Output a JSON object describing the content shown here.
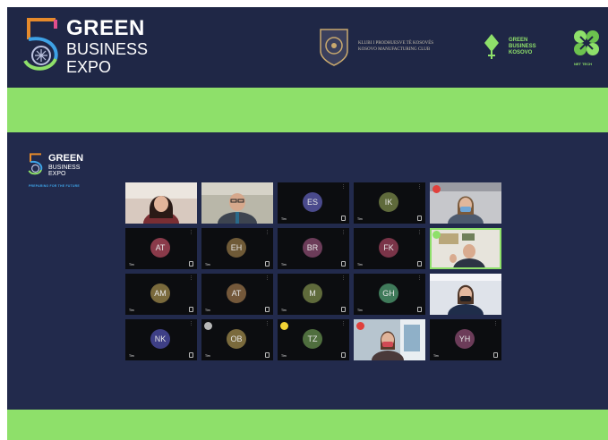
{
  "header": {
    "logo_number": "5",
    "logo_line1": "GREEN",
    "logo_line2": "BUSINESS",
    "logo_line3": "EXPO",
    "kmc_line1": "KLUBI I PRODHUESVE TË KOSOVËS",
    "kmc_line2": "KOSOVO MANUFACTURING CLUB",
    "gbk_line1": "GREEN",
    "gbk_line2": "BUSINESS",
    "gbk_line3": "KOSOVO",
    "nt_label": "NET TECH"
  },
  "sidebar": {
    "logo_line1": "GREEN",
    "logo_line2": "BUSINESS",
    "logo_line3": "EXPO",
    "tagline": "PREPARING FOR THE FUTURE"
  },
  "colors": {
    "page_bg": "#232b4f",
    "accent_green": "#8ee06a",
    "tile_bg": "#0c0d10",
    "alert_red": "#e0403c"
  },
  "participants": [
    {
      "initials": "",
      "video": "woman-dark-hair",
      "name_tag": "",
      "badge": "",
      "active": false
    },
    {
      "initials": "",
      "video": "man-with-glasses",
      "name_tag": "",
      "badge": "",
      "active": false
    },
    {
      "initials": "ES",
      "video": "",
      "avatar_color": "#4a4a8c",
      "name_tag": "Tim",
      "badge": "",
      "active": false
    },
    {
      "initials": "IK",
      "video": "",
      "avatar_color": "#5f6a3b",
      "name_tag": "Tim",
      "badge": "",
      "active": false
    },
    {
      "initials": "",
      "video": "woman-blue-mask",
      "name_tag": "",
      "badge": "red",
      "active": false
    },
    {
      "initials": "AT",
      "video": "",
      "avatar_color": "#8a3a4a",
      "name_tag": "Tim",
      "badge": "",
      "active": false
    },
    {
      "initials": "EH",
      "video": "",
      "avatar_color": "#6f5a37",
      "name_tag": "Tim",
      "badge": "",
      "active": false
    },
    {
      "initials": "BR",
      "video": "",
      "avatar_color": "#6c3c59",
      "name_tag": "Tim",
      "badge": "",
      "active": false
    },
    {
      "initials": "FK",
      "video": "",
      "avatar_color": "#7a3448",
      "name_tag": "Tim",
      "badge": "",
      "active": false
    },
    {
      "initials": "",
      "video": "man-speaking",
      "name_tag": "",
      "badge": "green",
      "active": true
    },
    {
      "initials": "AM",
      "video": "",
      "avatar_color": "#7a6a3c",
      "name_tag": "Tim",
      "badge": "",
      "active": false
    },
    {
      "initials": "AT",
      "video": "",
      "avatar_color": "#74583a",
      "name_tag": "Tim",
      "badge": "",
      "active": false
    },
    {
      "initials": "M",
      "video": "",
      "avatar_color": "#5f6a3b",
      "name_tag": "Tim",
      "badge": "",
      "active": false
    },
    {
      "initials": "GH",
      "video": "",
      "avatar_color": "#3f7a5a",
      "name_tag": "Tim",
      "badge": "",
      "active": false
    },
    {
      "initials": "",
      "video": "woman-black-mask",
      "name_tag": "",
      "badge": "",
      "active": false
    },
    {
      "initials": "NK",
      "video": "",
      "avatar_color": "#3e3f86",
      "name_tag": "Tim",
      "badge": "",
      "active": false
    },
    {
      "initials": "OB",
      "video": "",
      "avatar_color": "#7a6a3c",
      "name_tag": "Tim",
      "badge": "grey",
      "active": false
    },
    {
      "initials": "TZ",
      "video": "",
      "avatar_color": "#4f6e3e",
      "name_tag": "Tim",
      "badge": "yellow",
      "active": false
    },
    {
      "initials": "",
      "video": "woman-red-mask",
      "name_tag": "",
      "badge": "red",
      "active": false
    },
    {
      "initials": "YH",
      "video": "",
      "avatar_color": "#6c3c59",
      "name_tag": "Tim",
      "badge": "",
      "active": false
    }
  ]
}
